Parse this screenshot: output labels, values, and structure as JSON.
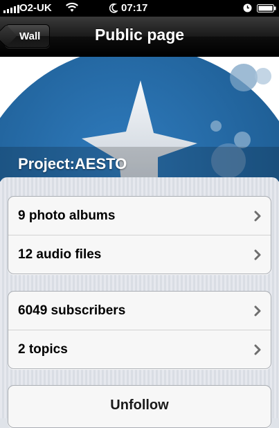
{
  "status_bar": {
    "carrier": "O2-UK",
    "time": "07:17",
    "icons": [
      "signal-icon",
      "wifi-icon",
      "moon-icon",
      "clock-icon",
      "battery-icon"
    ]
  },
  "nav": {
    "back_label": "Wall",
    "title": "Public page"
  },
  "header": {
    "page_name": "Project:AESTO",
    "colors": {
      "circle": "#1f5f96",
      "star": "#e9edf1"
    }
  },
  "groups": [
    {
      "rows": [
        {
          "label": "9 photo albums"
        },
        {
          "label": "12 audio files"
        }
      ]
    },
    {
      "rows": [
        {
          "label": "6049 subscribers"
        },
        {
          "label": "2 topics"
        }
      ]
    }
  ],
  "actions": {
    "unfollow_label": "Unfollow"
  }
}
